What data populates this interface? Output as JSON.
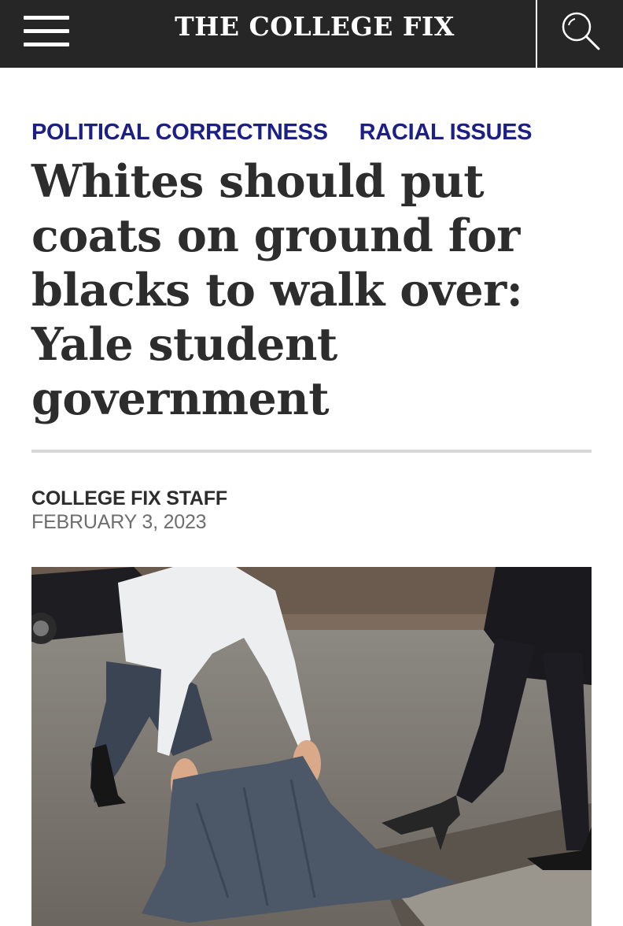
{
  "header": {
    "site_title": "THE COLLEGE FIX",
    "menu_icon": "hamburger-menu-icon",
    "search_icon": "search-icon",
    "background_color": "#262626"
  },
  "article": {
    "categories": [
      "POLITICAL CORRECTNESS",
      "RACIAL ISSUES"
    ],
    "category_color": "#1b1f86",
    "title_lines": [
      "Whites should put",
      "coats on ground for",
      "blacks to walk over:",
      "Yale student",
      "government"
    ],
    "author": "COLLEGE FIX STAFF",
    "date": "FEBRUARY 3, 2023",
    "hero_image": "photo-man-laying-coat-on-ground-for-woman"
  }
}
